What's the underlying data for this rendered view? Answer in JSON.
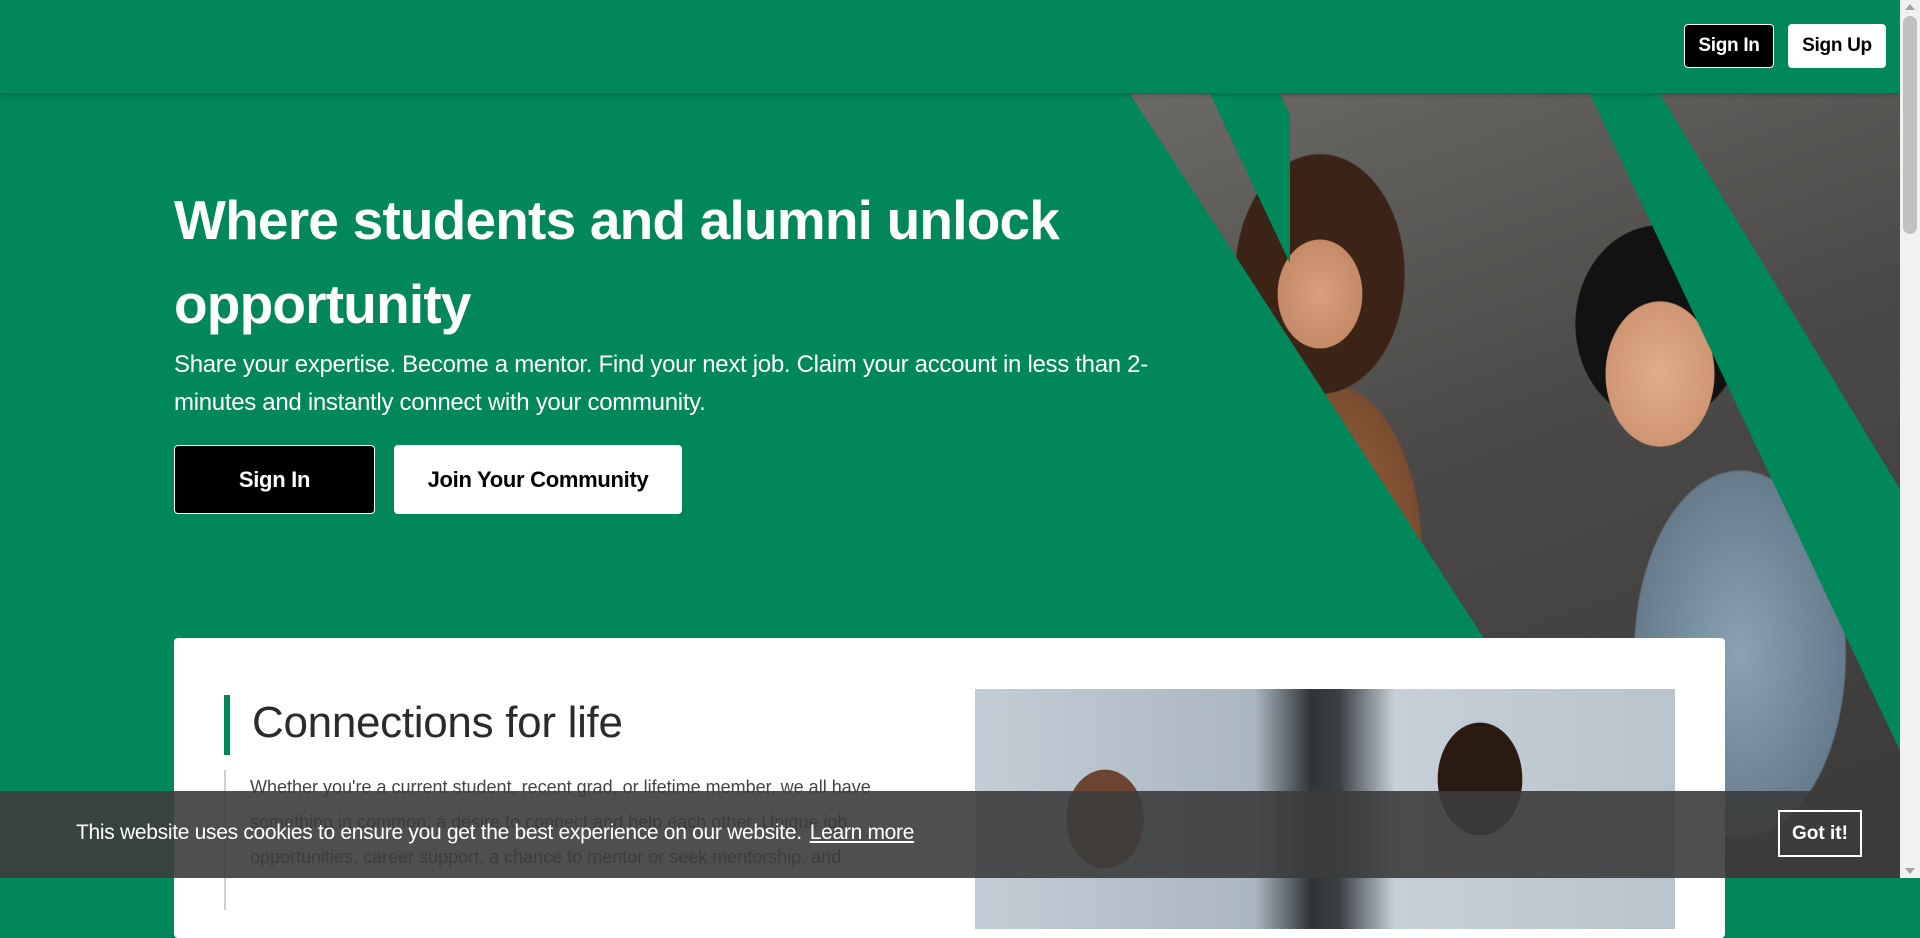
{
  "header": {
    "sign_in_label": "Sign In",
    "sign_up_label": "Sign Up"
  },
  "hero": {
    "title": "Where students and alumni unlock opportunity",
    "subtitle": "Share your expertise. Become a mentor. Find your next job. Claim your account in less than 2-minutes and instantly connect with your community.",
    "sign_in_label": "Sign In",
    "join_label": "Join Your Community"
  },
  "card": {
    "title": "Connections for life",
    "text": "Whether you're a current student, recent grad, or lifetime member, we all have something in common: a desire to connect and help each other. Unique job opportunities, career support, a chance to mentor or seek mentorship, and"
  },
  "cookie": {
    "message": "This website uses cookies to ensure you get the best experience on our website.",
    "link_label": "Learn more",
    "button_label": "Got it!"
  },
  "colors": {
    "brand_green": "#00875a",
    "black": "#000000",
    "white": "#ffffff"
  }
}
